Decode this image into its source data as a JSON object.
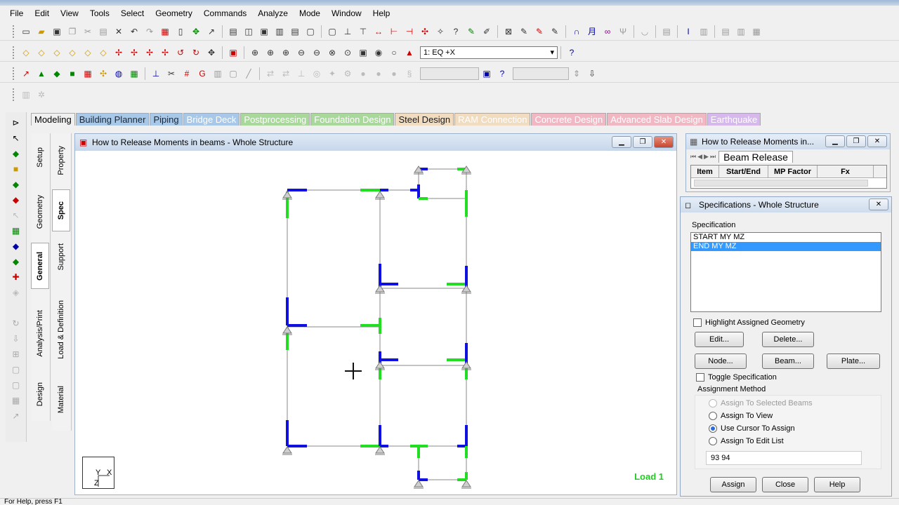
{
  "menu": [
    "File",
    "Edit",
    "View",
    "Tools",
    "Select",
    "Geometry",
    "Commands",
    "Analyze",
    "Mode",
    "Window",
    "Help"
  ],
  "toolbar": {
    "load_case": "1: EQ +X"
  },
  "mode_tabs": [
    {
      "label": "Modeling",
      "bg": "#f0f0f0",
      "fg": "#000000"
    },
    {
      "label": "Building Planner",
      "bg": "#a7c8e8",
      "fg": "#1a2a3a"
    },
    {
      "label": "Piping",
      "bg": "#a7c8e8",
      "fg": "#1a2a3a"
    },
    {
      "label": "Bridge Deck",
      "bg": "#a7c8e8",
      "fg": "#ffffff"
    },
    {
      "label": "Postprocessing",
      "bg": "#a8d89a",
      "fg": "#ffffff"
    },
    {
      "label": "Foundation Design",
      "bg": "#a8d89a",
      "fg": "#ffffff"
    },
    {
      "label": "Steel Design",
      "bg": "#f2dcc0",
      "fg": "#1a1a1a"
    },
    {
      "label": "RAM Connection",
      "bg": "#f2dcc0",
      "fg": "#ffffff"
    },
    {
      "label": "Concrete Design",
      "bg": "#f1b8c4",
      "fg": "#ffffff"
    },
    {
      "label": "Advanced Slab Design",
      "bg": "#f1b8c4",
      "fg": "#ffffff"
    },
    {
      "label": "Earthquake",
      "bg": "#d6b8ec",
      "fg": "#ffffff"
    }
  ],
  "vtabs_outer": [
    "Setup",
    "Geometry",
    "General",
    "Analysis/Print",
    "Design"
  ],
  "vtabs_inner": [
    "Property",
    "Spec",
    "Support",
    "Load & Definition",
    "Material"
  ],
  "viewport": {
    "title": "How to Release Moments in beams - Whole Structure",
    "load_label": "Load 1",
    "axis_y": "Y",
    "axis_x": "X",
    "axis_z": "Z"
  },
  "beam_release_panel": {
    "title": "How to Release Moments in...",
    "tab": "Beam Release",
    "columns": [
      "Item",
      "Start/End",
      "MP Factor",
      "Fx"
    ]
  },
  "spec_dialog": {
    "title": "Specifications - Whole Structure",
    "group_label": "Specification",
    "items": [
      {
        "label": "START MY MZ",
        "selected": false
      },
      {
        "label": "END MY MZ",
        "selected": true
      }
    ],
    "highlight_label": "Highlight Assigned Geometry",
    "edit_label": "Edit...",
    "delete_label": "Delete...",
    "node_label": "Node...",
    "beam_label": "Beam...",
    "plate_label": "Plate...",
    "toggle_label": "Toggle Specification",
    "method_label": "Assignment Method",
    "methods": [
      {
        "label": "Assign To Selected Beams",
        "checked": false,
        "disabled": true
      },
      {
        "label": "Assign To View",
        "checked": false,
        "disabled": false
      },
      {
        "label": "Use Cursor To Assign",
        "checked": true,
        "disabled": false
      },
      {
        "label": "Assign To Edit List",
        "checked": false,
        "disabled": false
      }
    ],
    "edit_list_value": "93 94",
    "assign_label": "Assign",
    "close_label": "Close",
    "help_label": "Help"
  },
  "statusbar": {
    "left": "For Help, press F1"
  },
  "colors": {
    "release_start": "#1010e0",
    "release_end": "#22dd22",
    "member": "#8a8a8a",
    "support": "#777777"
  }
}
